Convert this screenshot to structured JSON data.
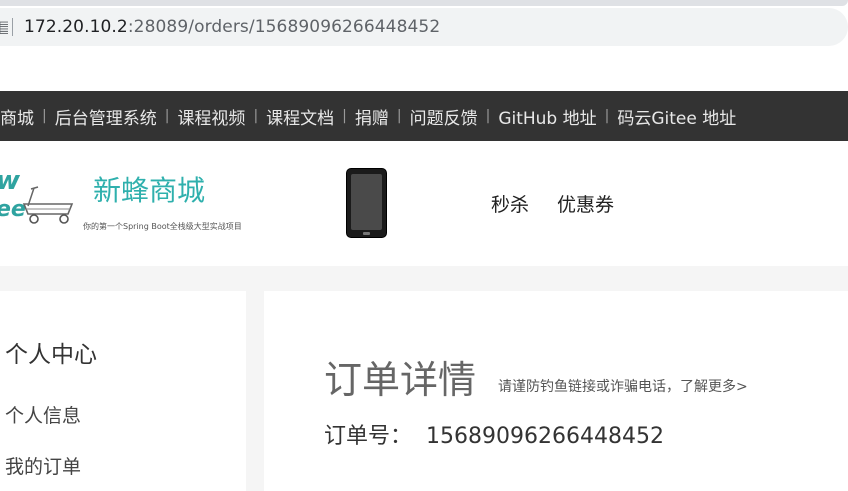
{
  "browser": {
    "url_host": "172.20.10.2",
    "url_rest": ":28089/orders/15689096266448452"
  },
  "topnav": {
    "items": [
      "商城",
      "后台管理系统",
      "课程视频",
      "课程文档",
      "捐赠",
      "问题反馈",
      "GitHub 地址",
      "码云Gitee 地址"
    ]
  },
  "header": {
    "logo_line1": "w",
    "logo_line2": "ee",
    "brand_title": "新蜂商城",
    "brand_subtitle": "你的第一个Spring Boot全栈级大型实战项目",
    "links": [
      "秒杀",
      "优惠券"
    ]
  },
  "sidebar": {
    "title": "个人中心",
    "items": [
      "个人信息",
      "我的订单"
    ]
  },
  "main": {
    "title": "订单详情",
    "notice": "请谨防钓鱼链接或诈骗电话，了解更多>",
    "order_no_label": "订单号：",
    "order_no": "15689096266448452"
  }
}
